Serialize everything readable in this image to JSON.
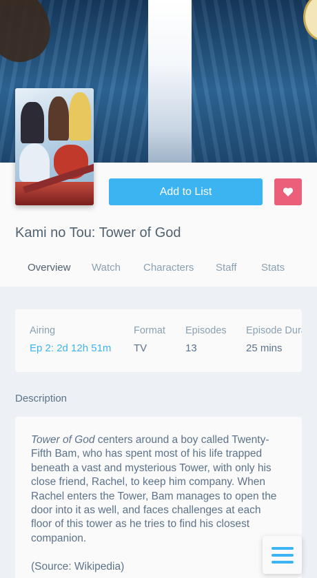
{
  "header": {
    "add_to_list_label": "Add to List",
    "title": "Kami no Tou: Tower of God"
  },
  "tabs": [
    {
      "label": "Overview",
      "active": true
    },
    {
      "label": "Watch",
      "active": false
    },
    {
      "label": "Characters",
      "active": false
    },
    {
      "label": "Staff",
      "active": false
    },
    {
      "label": "Stats",
      "active": false
    }
  ],
  "info": {
    "airing_label": "Airing",
    "airing_value": "Ep 2: 2d 12h 51m",
    "format_label": "Format",
    "format_value": "TV",
    "episodes_label": "Episodes",
    "episodes_value": "13",
    "duration_label": "Episode Dura",
    "duration_value": "25 mins"
  },
  "description": {
    "heading": "Description",
    "title_italic": "Tower of God",
    "body": " centers around a boy called Twenty-Fifth Bam, who has spent most of his life trapped beneath a vast and mysterious Tower, with only his close friend, Rachel, to keep him company. When Rachel enters the Tower, Bam manages to open the door into it as well, and faces challenges at each floor of this tower as he tries to find his closest companion.",
    "source": "(Source: Wikipedia)"
  },
  "icons": {
    "favorite": "heart-icon",
    "menu": "hamburger-menu-icon"
  },
  "colors": {
    "accent": "#3db4f2",
    "favorite": "#ec5f7a",
    "background": "#edf1f5"
  }
}
